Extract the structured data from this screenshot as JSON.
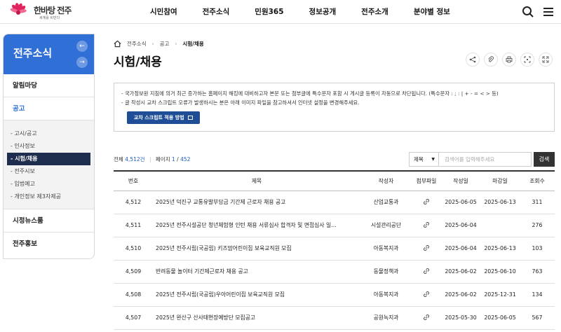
{
  "header": {
    "logo_main": "한바탕 전주",
    "logo_sub": "세계를 비빈다",
    "nav": [
      "시민참여",
      "전주소식",
      "민원365",
      "정보공개",
      "전주소개",
      "분야별 정보"
    ]
  },
  "sidebar": {
    "title": "전주소식",
    "menu_top": "알림마당",
    "menu_active": "공고",
    "sub_items": [
      "- 고시/공고",
      "- 인사정보",
      "- 시험/채용",
      "- 전주시보",
      "- 입법예고",
      "- 개인정보 제3자제공"
    ],
    "menu_bottom": [
      "시정뉴스룸",
      "전주홍보"
    ]
  },
  "breadcrumb": [
    "전주소식",
    "공고",
    "시험/채용"
  ],
  "page_title": "시험/채용",
  "notice": {
    "line1": "- 국가정보원 지침에 의거 최근 증가하는 홈페이지 해킹에 대비하고자 본문 또는 첨부글에 특수문자 포함 시 게시글 등록이 자동으로 차단됩니다. (특수문자 : ; : | + - = < > 등)",
    "line2": "- 글 작성시 교차 스크립트 오류가 발생하시는 분은 아래 이미지 파일을 참고하셔서 인터넷 설정을 변경해주세요.",
    "button": "교차 스크립트 적용 방법"
  },
  "list_info": {
    "total_label": "전체",
    "total": "4,512건",
    "page_label": "페이지",
    "page": "1",
    "page_total": "452"
  },
  "search": {
    "select": "제목",
    "placeholder": "검색어를 입력해주세요",
    "button": "검색"
  },
  "table": {
    "headers": [
      "번호",
      "제목",
      "작성자",
      "첨부파일",
      "작성일",
      "마감일",
      "조회수"
    ],
    "rows": [
      {
        "no": "4,512",
        "title": "2025년 덕진구 교통유발부담금 기간제 근로자 채용 공고",
        "author": "산업교통과",
        "date": "2025-06-05",
        "deadline": "2025-06-13",
        "views": "311"
      },
      {
        "no": "4,511",
        "title": "2025년 전주시설공단 청년체험형 인턴 채용 서류심사 합격자 및 면접심사 일...",
        "author": "시설관리공단",
        "date": "2025-06-04",
        "deadline": "",
        "views": "276"
      },
      {
        "no": "4,510",
        "title": "2025년 전주시립(국공립) 키즈맘어린이집 보육교직원 모집",
        "author": "아동복지과",
        "date": "2025-06-04",
        "deadline": "2025-06-13",
        "views": "103"
      },
      {
        "no": "4,509",
        "title": "반려동물 놀이터 기간제근로자 채용 공고",
        "author": "동물정책과",
        "date": "2025-06-02",
        "deadline": "2025-06-10",
        "views": "763"
      },
      {
        "no": "4,508",
        "title": "2025년 전주시립(국공립)우아어린이집 보육교직원 모집",
        "author": "아동복지과",
        "date": "2025-06-02",
        "deadline": "2025-12-31",
        "views": "134"
      },
      {
        "no": "4,507",
        "title": "2025년 완산구 산사태현장예방단 모집공고",
        "author": "공원녹지과",
        "date": "2025-05-30",
        "deadline": "2025-06-05",
        "views": "567"
      }
    ]
  },
  "colors": {
    "accent": "#2f6fd6",
    "active_sub": "#1f2d4e",
    "button_dark": "#1f4e96",
    "logo_flower": "#e0245e"
  }
}
